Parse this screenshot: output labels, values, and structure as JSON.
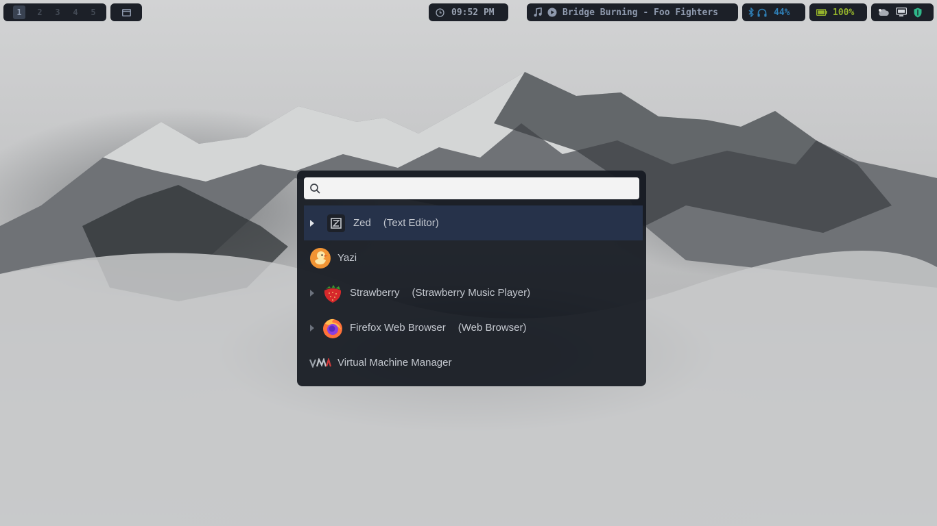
{
  "topbar": {
    "workspaces": [
      "1",
      "2",
      "3",
      "4",
      "5"
    ],
    "active_workspace": "1",
    "window_icon": "window-icon",
    "clock": {
      "icon": "clock-icon",
      "time": "09:52 PM"
    },
    "media": {
      "note_icon": "music-note-icon",
      "play_icon": "play-icon",
      "track": "Bridge Burning - Foo Fighters"
    },
    "bluetooth": {
      "icon": "bluetooth-icon",
      "headphones_icon": "headphones-icon",
      "level": "44%"
    },
    "battery": {
      "icon": "battery-icon",
      "level": "100%"
    },
    "tray": [
      "cloud-icon",
      "display-icon",
      "shield-icon"
    ]
  },
  "launcher": {
    "search": {
      "placeholder": "",
      "value": ""
    },
    "results": [
      {
        "name": "Zed",
        "desc": "(Text Editor)",
        "icon": "zed-icon",
        "expandable": true,
        "selected": true
      },
      {
        "name": "Yazi",
        "desc": "",
        "icon": "yazi-icon",
        "expandable": false,
        "selected": false
      },
      {
        "name": "Strawberry",
        "desc": "(Strawberry Music Player)",
        "icon": "strawberry-icon",
        "expandable": true,
        "selected": false
      },
      {
        "name": "Firefox Web Browser",
        "desc": "(Web Browser)",
        "icon": "firefox-icon",
        "expandable": true,
        "selected": false
      },
      {
        "name": "Virtual Machine Manager",
        "desc": "",
        "icon": "virt-manager-icon",
        "expandable": false,
        "selected": false
      }
    ]
  },
  "colors": {
    "bar_bg": "#1c2028",
    "launcher_bg": "#161a21",
    "selected_row": "#26324a",
    "battery_green": "#95b32c",
    "bluetooth_blue": "#2f80b8"
  }
}
